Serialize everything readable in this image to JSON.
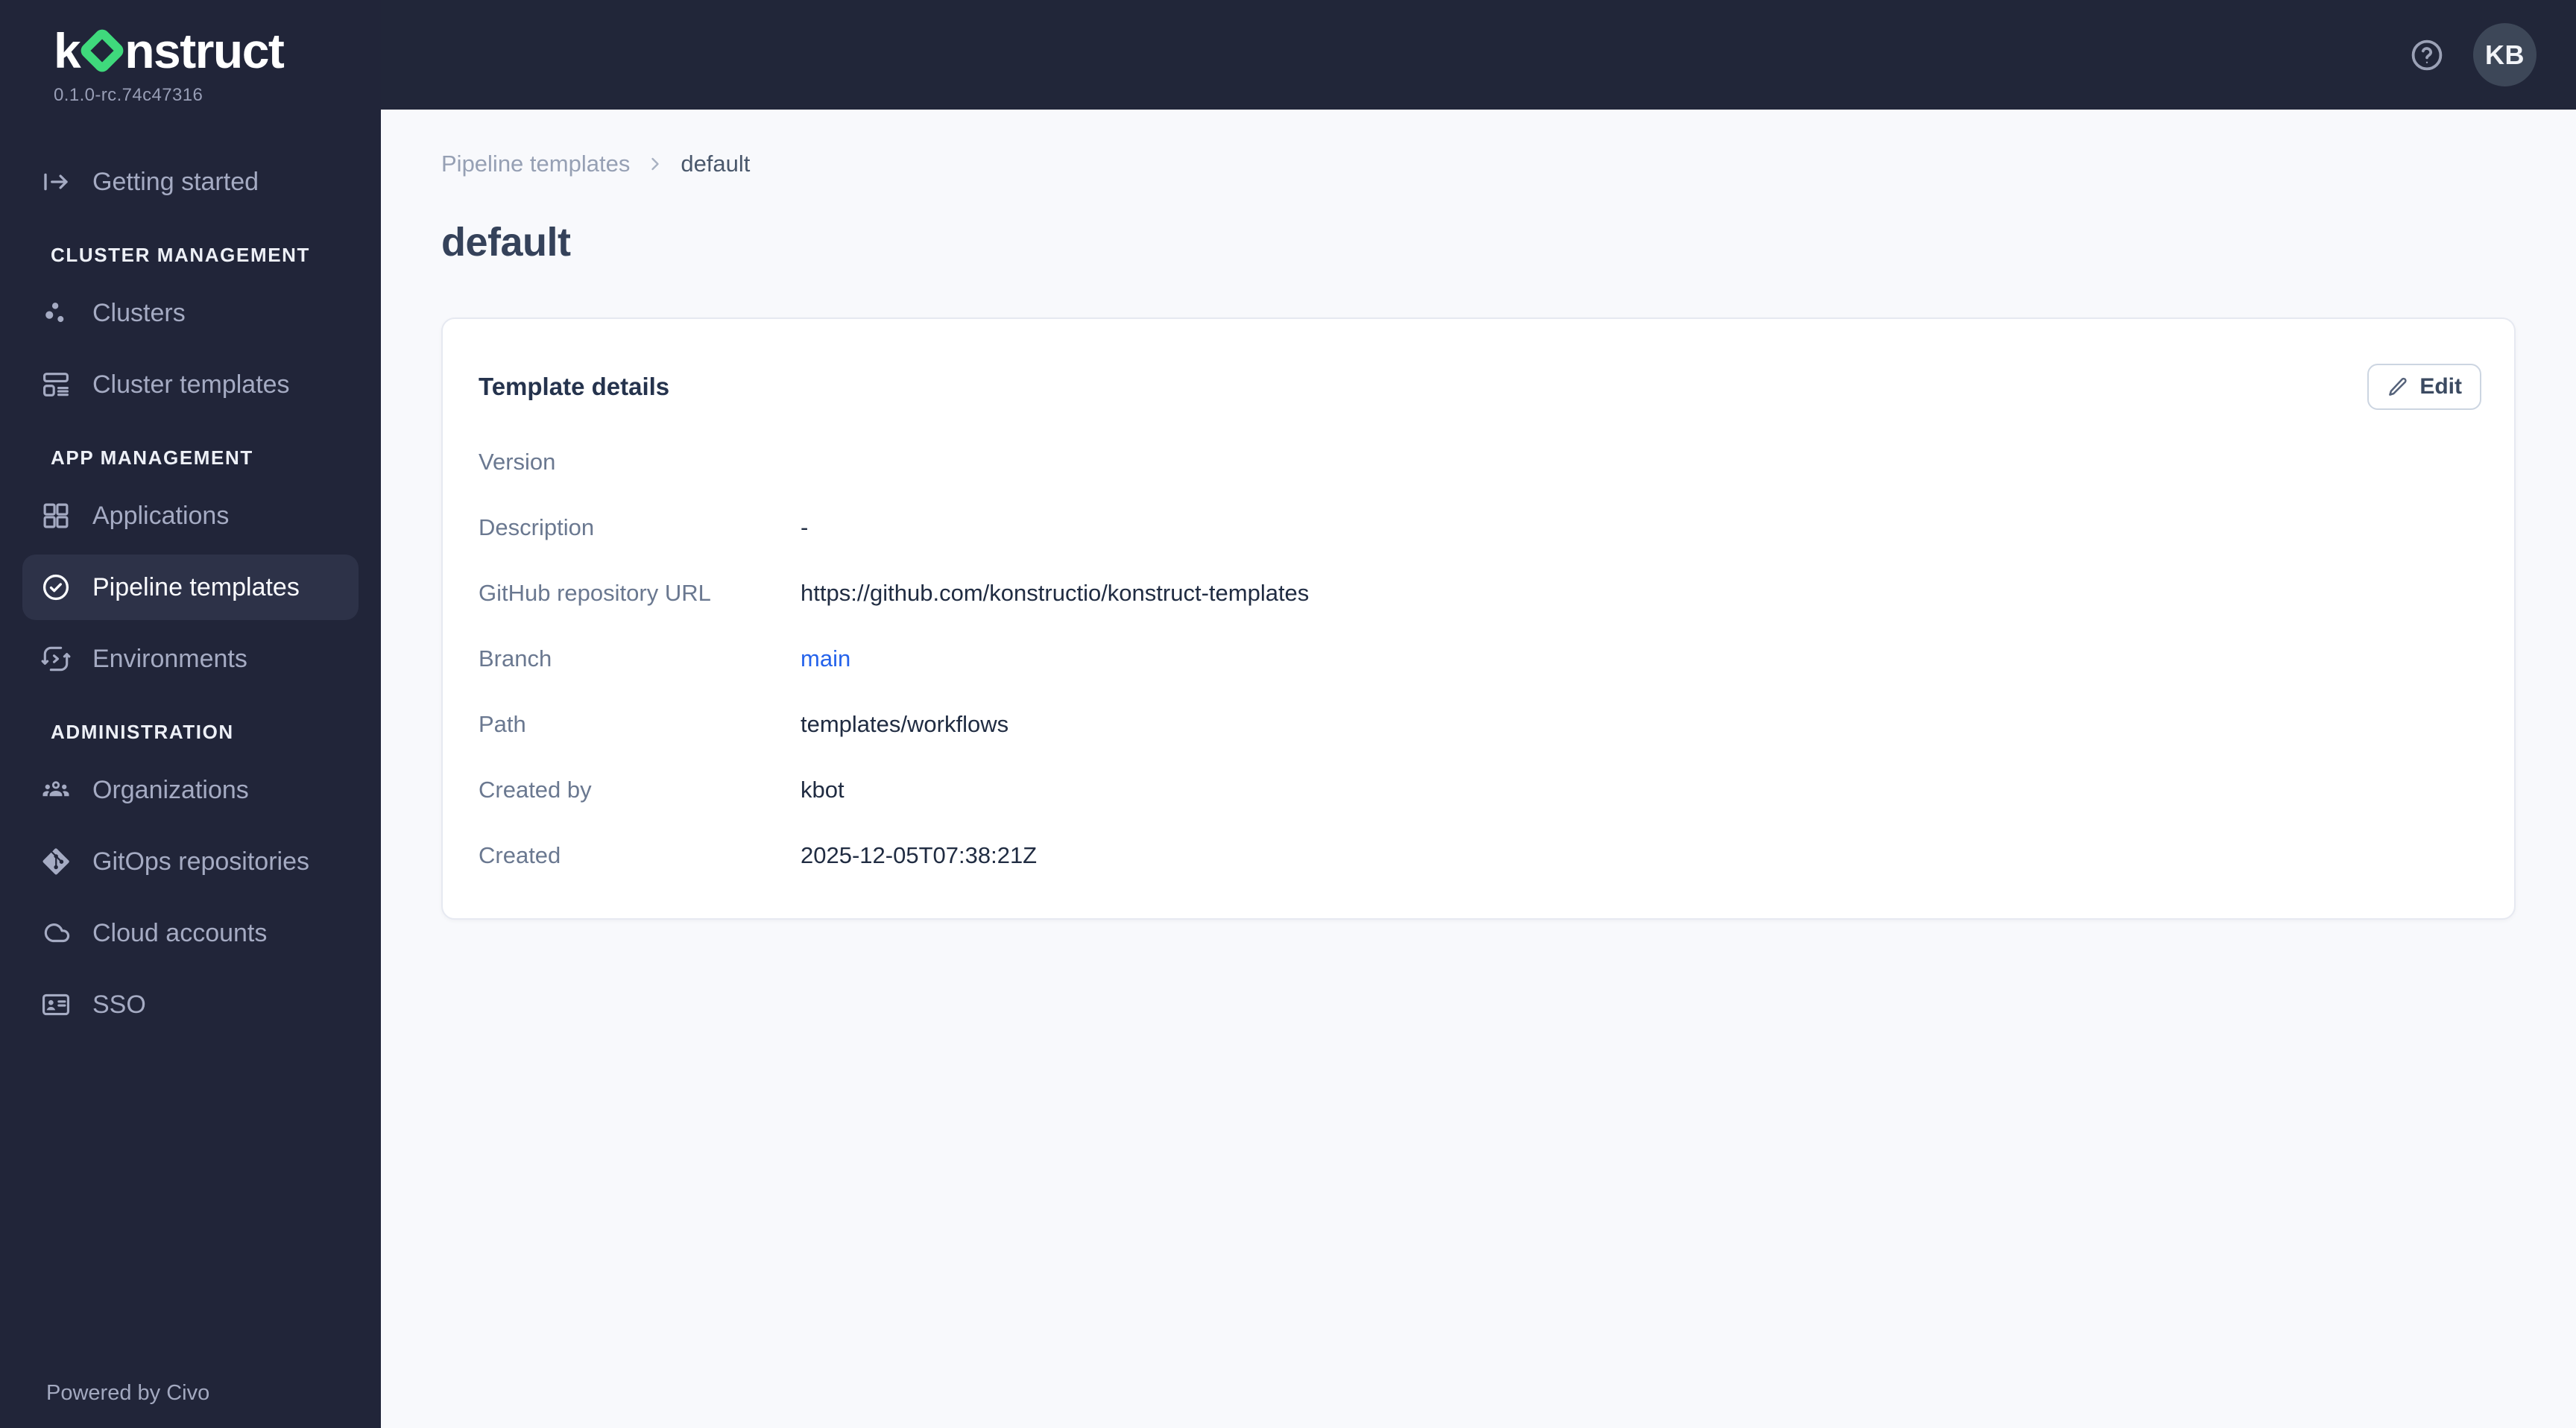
{
  "brand": {
    "name": "konstruct",
    "logo_prefix": "k",
    "logo_suffix": "nstruct",
    "version": "0.1.0-rc.74c47316"
  },
  "sidebar": {
    "getting_started": "Getting started",
    "sections": {
      "cluster_management": "CLUSTER MANAGEMENT",
      "app_management": "APP MANAGEMENT",
      "administration": "ADMINISTRATION"
    },
    "items": {
      "clusters": "Clusters",
      "cluster_templates": "Cluster templates",
      "applications": "Applications",
      "pipeline_templates": "Pipeline templates",
      "environments": "Environments",
      "organizations": "Organizations",
      "gitops_repositories": "GitOps repositories",
      "cloud_accounts": "Cloud accounts",
      "sso": "SSO"
    },
    "active_item": "Pipeline templates",
    "footer": "Powered by Civo"
  },
  "topbar": {
    "avatar_initials": "KB"
  },
  "breadcrumb": {
    "parent": "Pipeline templates",
    "current": "default"
  },
  "page": {
    "title": "default"
  },
  "card": {
    "title": "Template details",
    "edit_label": "Edit",
    "fields": [
      {
        "label": "Version",
        "value": ""
      },
      {
        "label": "Description",
        "value": "-"
      },
      {
        "label": "GitHub repository URL",
        "value": "https://github.com/konstructio/konstruct-templates"
      },
      {
        "label": "Branch",
        "value": "main"
      },
      {
        "label": "Path",
        "value": "templates/workflows"
      },
      {
        "label": "Created by",
        "value": "kbot"
      },
      {
        "label": "Created",
        "value": "2025-12-05T07:38:21Z"
      }
    ]
  },
  "icons": {
    "logo_diamond": "green-diamond",
    "getting_started": "arrow-right-from-line",
    "clusters": "scatter-dots",
    "cluster_templates": "layout-list",
    "applications": "grid-2x2",
    "pipeline_templates": "check-circle",
    "environments": "code-sync-loop",
    "organizations": "people-group",
    "gitops_repositories": "git-logo",
    "cloud_accounts": "cloud",
    "sso": "id-card",
    "help": "help-circle",
    "edit": "pencil",
    "breadcrumb_separator": "chevron-right"
  },
  "colors": {
    "accent_green": "#3fd97c",
    "link_blue": "#2563eb",
    "sidebar_bg": "#212539",
    "topbar_bg": "#212639",
    "active_item_bg": "#2d3248",
    "content_bg": "#f8f9fc",
    "card_border": "#e6e9f1"
  }
}
